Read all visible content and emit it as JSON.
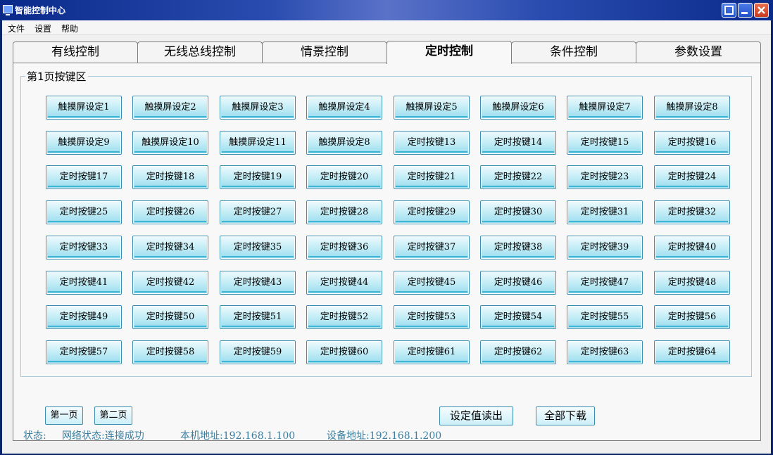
{
  "window": {
    "title": "智能控制中心"
  },
  "menu": {
    "items": [
      "文件",
      "设置",
      "帮助"
    ]
  },
  "tabs": [
    {
      "label": "有线控制",
      "active": false
    },
    {
      "label": "无线总线控制",
      "active": false
    },
    {
      "label": "情景控制",
      "active": false
    },
    {
      "label": "定时控制",
      "active": true
    },
    {
      "label": "条件控制",
      "active": false
    },
    {
      "label": "参数设置",
      "active": false
    }
  ],
  "group": {
    "title": "第1页按键区",
    "keys": [
      "触摸屏设定1",
      "触摸屏设定2",
      "触摸屏设定3",
      "触摸屏设定4",
      "触摸屏设定5",
      "触摸屏设定6",
      "触摸屏设定7",
      "触摸屏设定8",
      "触摸屏设定9",
      "触摸屏设定10",
      "触摸屏设定11",
      "触摸屏设定8",
      "定时按键13",
      "定时按键14",
      "定时按键15",
      "定时按键16",
      "定时按键17",
      "定时按键18",
      "定时按键19",
      "定时按键20",
      "定时按键21",
      "定时按键22",
      "定时按键23",
      "定时按键24",
      "定时按键25",
      "定时按键26",
      "定时按键27",
      "定时按键28",
      "定时按键29",
      "定时按键30",
      "定时按键31",
      "定时按键32",
      "定时按键33",
      "定时按键34",
      "定时按键35",
      "定时按键36",
      "定时按键37",
      "定时按键38",
      "定时按键39",
      "定时按键40",
      "定时按键41",
      "定时按键42",
      "定时按键43",
      "定时按键44",
      "定时按键45",
      "定时按键46",
      "定时按键47",
      "定时按键48",
      "定时按键49",
      "定时按键50",
      "定时按键51",
      "定时按键52",
      "定时按键53",
      "定时按键54",
      "定时按键55",
      "定时按键56",
      "定时按键57",
      "定时按键58",
      "定时按键59",
      "定时按键60",
      "定时按键61",
      "定时按键62",
      "定时按键63",
      "定时按键64"
    ]
  },
  "actions": {
    "first_page": "第一页",
    "second_page": "第二页",
    "read_settings": "设定值读出",
    "download_all": "全部下载"
  },
  "status": {
    "label": "状态:",
    "network": "网络状态:连接成功",
    "local_address": "本机地址:192.168.1.100",
    "device_address": "设备地址:192.168.1.200"
  },
  "colors": {
    "titlebar": "#0a246a",
    "accent": "#3a8fb0",
    "status_text": "#3a7fa0"
  }
}
